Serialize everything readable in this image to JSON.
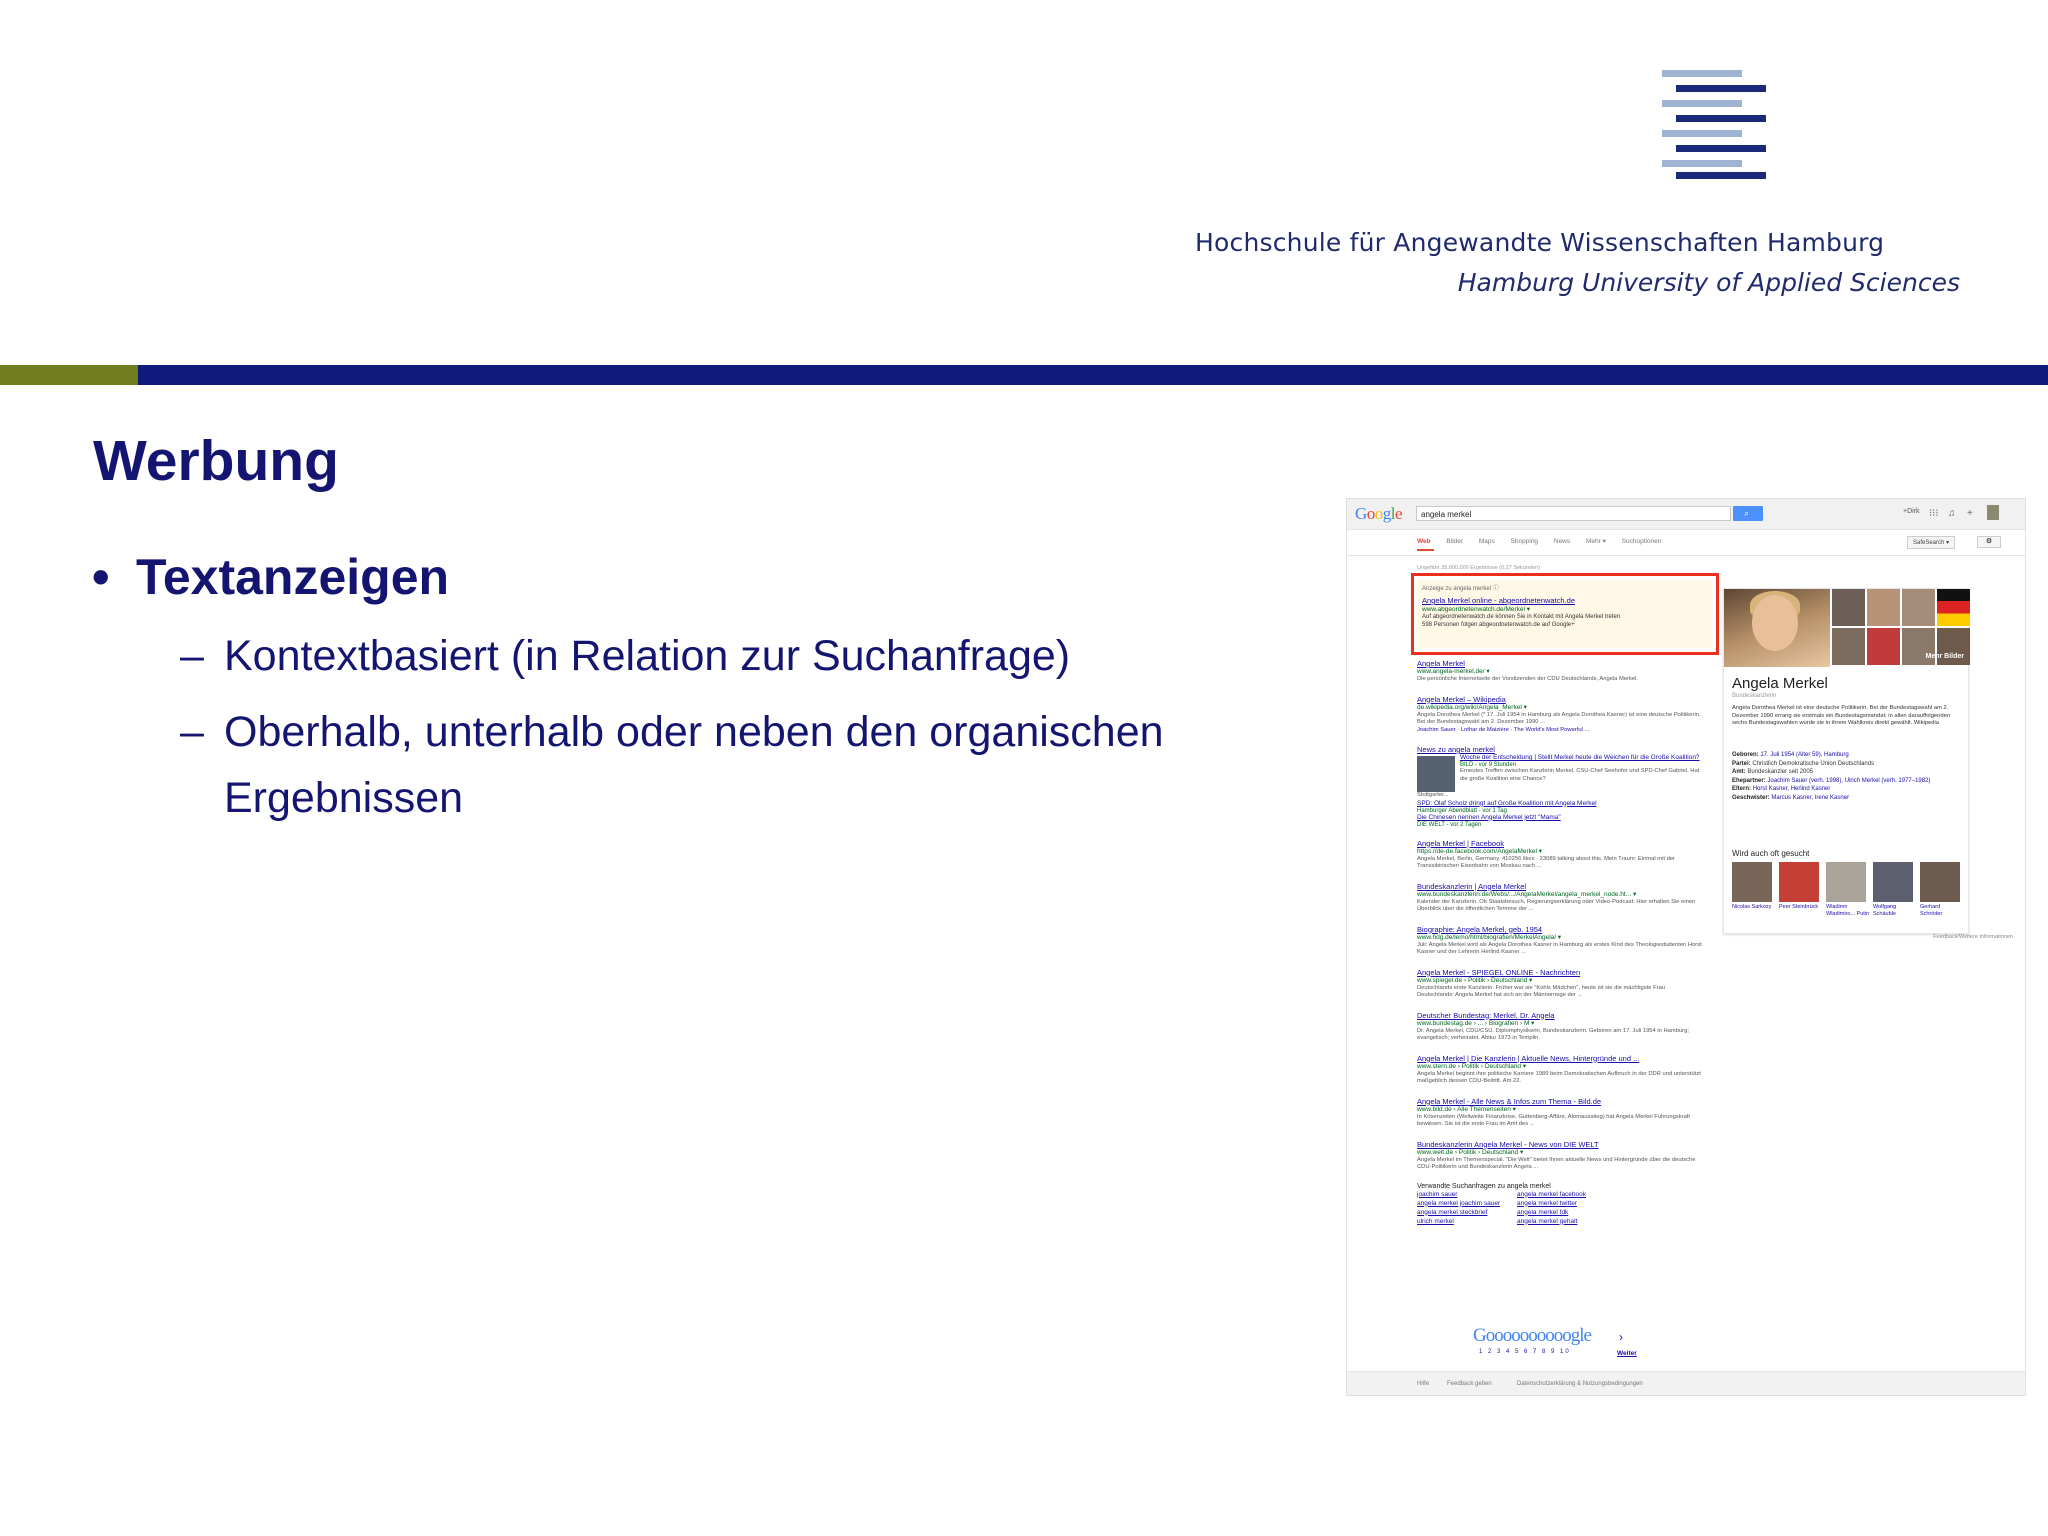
{
  "colors": {
    "navy": "#141570",
    "bar_blue": "#101a7c",
    "bar_green": "#6f7d1e",
    "logo_light": "#9fb3d3",
    "logo_dark": "#1b2a78",
    "ad_border": "#e8301c"
  },
  "header": {
    "institution_de": "Hochschule für Angewandte Wissenschaften Hamburg",
    "institution_en": "Hamburg University of Applied Sciences"
  },
  "slide": {
    "title": "Werbung",
    "bullet_symbol": "•",
    "bullet": "Textanzeigen",
    "dash": "–",
    "sub1": "Kontextbasiert (in Relation zur Suchanfrage)",
    "sub2_line1": "Oberhalb, unterhalb oder neben den organischen",
    "sub2_line2": "Ergebnissen"
  },
  "google": {
    "logo": "Google",
    "query": "angela merkel",
    "search_icon": "search-icon",
    "plus_user": "+Dirk",
    "tabs": [
      "Web",
      "Bilder",
      "Maps",
      "Shopping",
      "News",
      "Mehr ▾",
      "Suchoptionen"
    ],
    "safesearch": "SafeSearch ▾",
    "stats": "Ungefähr 35.800.000 Ergebnisse (0,27 Sekunden)",
    "ad": {
      "label": "Anzeige zu angela merkel ⓘ",
      "title": "Angela Merkel online - abgeordnetenwatch.de",
      "url": "www.abgeordnetenwatch.de/Merkel ▾",
      "text1": "Auf abgeordnetenwatch.de können Sie in Kontakt mit Angela Merkel treten",
      "text2": "598 Personen folgen abgeordnetenwatch.de auf Google+"
    },
    "results": [
      {
        "title": "Angela Merkel",
        "url": "www.angela-merkel.de/ ▾",
        "snippet": "Die persönliche Internetseite der Vorsitzenden der CDU Deutschlands, Angela Merkel."
      },
      {
        "title": "Angela Merkel – Wikipedia",
        "url": "de.wikipedia.org/wiki/Angela_Merkel ▾",
        "snippet": "Angela Dorothea Merkel (* 17. Juli 1954 in Hamburg als Angela Dorothea Kasner) ist eine deutsche Politikerin. Bei der Bundestagswahl am 2. Dezember 1990 ...",
        "links": "Joachim Sauer · Lothar de Maizière · The World's Most Powerful ..."
      }
    ],
    "news": {
      "title": "News zu angela merkel",
      "item_title": "Woche der Entscheidung | Stellt Merkel heute die Weichen für die Große Koalition?",
      "item_src": "BILD - vor 9 Stunden",
      "item_text": "Erneutes Treffen zwischen Kanzlerin Merkel, CSU-Chef Seehofer und SPD-Chef Gabriel. Hat die große Koalition eine Chance?",
      "place": "Stuttgarter...",
      "more1": "SPD: Olaf Scholz dringt auf Große Koalition mit Angela Merkel",
      "more1_src": "Hamburger Abendblatt - vor 1 Tag",
      "more2": "Die Chinesen nennen Angela Merkel jetzt \"Mama\"",
      "more2_src": "DIE WELT - vor 2 Tagen"
    },
    "results2": [
      {
        "title": "Angela Merkel | Facebook",
        "url": "https://de-de.facebook.com/AngelaMerkel ▾",
        "snippet": "Angela Merkel, Berlin, Germany. 410256 likes · 23089 talking about this. Mein Traum: Einmal mit der Transsibirischen Eisenbahn von Moskau nach ..."
      },
      {
        "title": "Bundeskanzlerin | Angela Merkel",
        "url": "www.bundeskanzlerin.de/Webs/.../AngelaMerkel/angela_merkel_node.ht... ▾",
        "snippet": "Kalender der Kanzlerin. Ob Staatsbesuch, Regierungserklärung oder Video-Podcast: Hier erhalten Sie einen Überblick über die öffentlichen Termine der ..."
      },
      {
        "title": "Biographie: Angela Merkel, geb. 1954",
        "url": "www.hdg.de/lemo/html/biografien/MerkelAngela/ ▾",
        "snippet": "Juli: Angela Merkel wird als Angela Dorothea Kasner in Hamburg als erstes Kind des Theologiestudenten Horst Kasner und der Lehrerin Herlind Kasner ..."
      },
      {
        "title": "Angela Merkel - SPIEGEL ONLINE - Nachrichten",
        "url": "www.spiegel.de › Politik › Deutschland ▾",
        "snippet": "Deutschlands erste Kanzlerin. Früher war sie \"Kohls Mädchen\", heute ist sie die mächtigste Frau Deutschlands: Angela Merkel hat sich an der Männerriege der ..."
      },
      {
        "title": "Deutscher Bundestag: Merkel, Dr. Angela",
        "url": "www.bundestag.de › ... › Biografien › M ▾",
        "snippet": "Dr. Angela Merkel, CDU/CSU. Diplomphysikerin, Bundeskanzlerin. Geboren am 17. Juli 1954 in Hamburg; evangelisch; verheiratet. Abitur 1973 in Templin."
      },
      {
        "title": "Angela Merkel | Die Kanzlerin | Aktuelle News, Hintergründe und ...",
        "url": "www.stern.de › Politik › Deutschland ▾",
        "snippet": "Angela Merkel beginnt ihre politische Karriere 1989 beim Demokratischen Aufbruch in der DDR und unterstützt maßgeblich dessen CDU-Beitritt. Am 22."
      },
      {
        "title": "Angela Merkel - Alle News & Infos zum Thema - Bild.de",
        "url": "www.bild.de › Alle Themenseiten ▾",
        "snippet": "In Krisenzeiten (Weltweite Finanzkrise, Guttenberg-Affäre, Atomausstieg) hat Angela Merkel Führungskraft bewiesen. Sie ist die erste Frau im Amt des ..."
      },
      {
        "title": "Bundeskanzlerin Angela Merkel - News von DIE WELT",
        "url": "www.welt.de › Politik › Deutschland ▾",
        "snippet": "Angela Merkel im Themenspecial. \"Die Welt\" bietet Ihnen aktuelle News und Hintergründe über die deutsche CDU-Politikerin und Bundeskanzlerin Angela ..."
      }
    ],
    "related": {
      "title": "Verwandte Suchanfragen zu angela merkel",
      "items": [
        "joachim sauer",
        "angela merkel facebook",
        "angela merkel joachim sauer",
        "angela merkel twitter",
        "angela merkel steckbrief",
        "angela merkel fdk",
        "ulrich merkel",
        "angela merkel gehalt"
      ]
    },
    "pager": {
      "logo": "Goooooooooogle",
      "arrow": "›",
      "pages": "1 2 3 4 5 6 7 8 9 10",
      "next": "Weiter"
    },
    "footer": [
      "Hilfe",
      "Feedback geben",
      "Datenschutzerklärung & Nutzungsbedingungen"
    ],
    "panel": {
      "more_images": "Mehr Bilder",
      "name": "Angela Merkel",
      "subtitle": "Bundeskanzlerin",
      "description": "Angela Dorothea Merkel ist eine deutsche Politikerin. Bei der Bundestagswahl am 2. Dezember 1990 errang sie erstmals ein Bundestagsmandat; in allen darauffolgenden sechs Bundestagswahlen wurde sie in ihrem Wahlkreis direkt gewählt. Wikipedia",
      "facts": [
        {
          "label": "Geboren:",
          "value": "17. Juli 1954 (Alter 59), Hamburg"
        },
        {
          "label": "Partei:",
          "value": "Christlich Demokratische Union Deutschlands"
        },
        {
          "label": "Amt:",
          "value": "Bundeskanzler seit 2005"
        },
        {
          "label": "Ehepartner:",
          "value": "Joachim Sauer (verh. 1998), Ulrich Merkel (verh. 1977–1982)"
        },
        {
          "label": "Eltern:",
          "value": "Horst Kasner, Herlind Kasner"
        },
        {
          "label": "Geschwister:",
          "value": "Marcus Kasner, Irene Kasner"
        }
      ],
      "people_title": "Wird auch oft gesucht",
      "people": [
        "Nicolas Sarkozy",
        "Peer Steinbrück",
        "Wladimir Wladimiro... Putin",
        "Wolfgang Schäuble",
        "Gerhard Schröder"
      ],
      "feedback": "Feedback/Weitere Informationen"
    }
  }
}
